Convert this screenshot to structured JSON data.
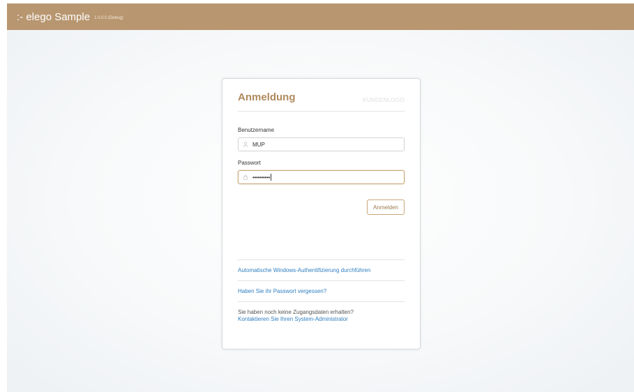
{
  "app": {
    "title": ":- elego Sample",
    "version": "1.0.0.0 (Debug)"
  },
  "login": {
    "title": "Anmeldung",
    "logo_text": "KUNDENLOGO",
    "username_label": "Benutzername",
    "username_value": "MUP",
    "password_label": "Passwort",
    "password_masked": "••••••••••",
    "submit_label": "Anmelden"
  },
  "links": {
    "windows_auth": "Automatische Windows-Authentifizierung durchführen",
    "forgot_password": "Haben Sie ihr Passwort vergessen?",
    "no_credentials_text": "Sie haben noch keine Zugangsdaten erhalten?",
    "contact_admin": "Kontaktieren Sie Ihren System-Administrator"
  },
  "colors": {
    "titlebar": "#b89670",
    "accent": "#b08a5c",
    "link": "#2f7fc1"
  },
  "icons": {
    "username_field": "user-icon",
    "password_field": "lock-icon"
  }
}
